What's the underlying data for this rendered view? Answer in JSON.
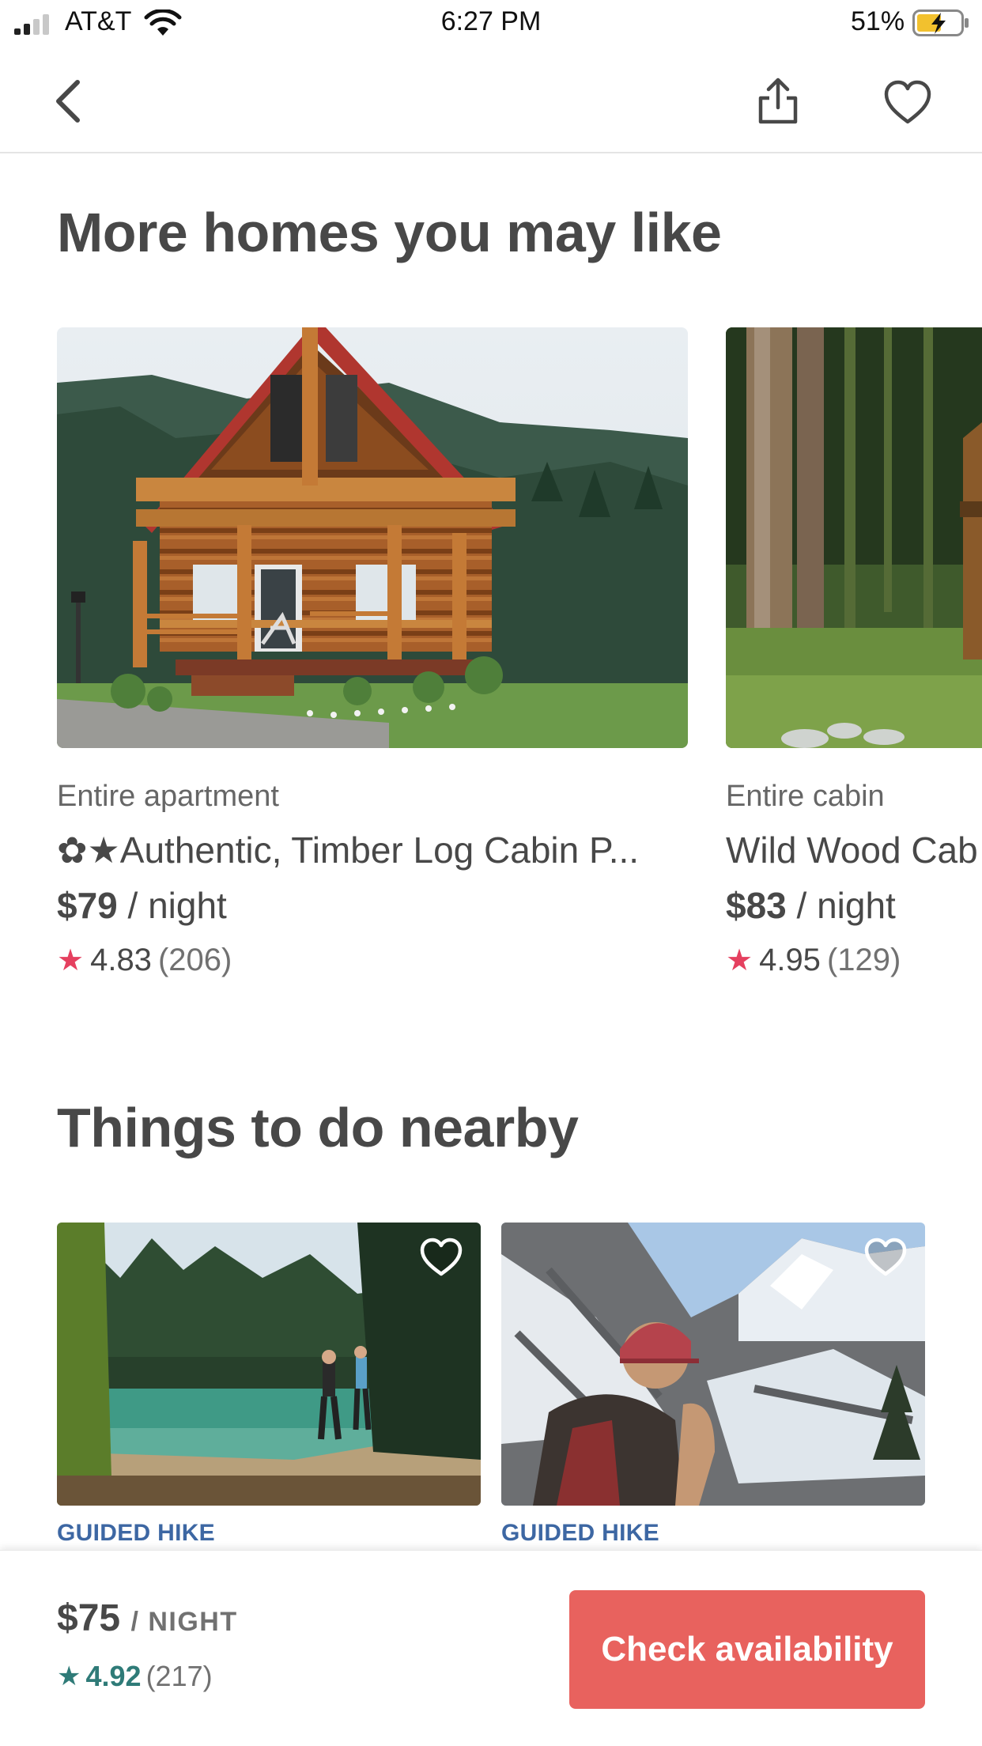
{
  "status_bar": {
    "carrier": "AT&T",
    "time": "6:27 PM",
    "battery_percent": "51%",
    "signal_bars_active": 2,
    "signal_bars_total": 4,
    "icons": [
      "signal-icon",
      "wifi-icon",
      "battery-charging-icon"
    ]
  },
  "nav": {
    "icons": [
      "back-chevron-icon",
      "share-icon",
      "heart-icon"
    ]
  },
  "more_homes": {
    "title": "More homes you may like",
    "listings": [
      {
        "type": "Entire apartment",
        "title": "✿★Authentic, Timber Log Cabin P...",
        "price": "$79",
        "price_unit": " / night",
        "rating": "4.83",
        "reviews": "(206)"
      },
      {
        "type": "Entire cabin",
        "title": "Wild Wood Cab",
        "price": "$83",
        "price_unit": " / night",
        "rating": "4.95",
        "reviews": "(129)"
      }
    ]
  },
  "things_to_do": {
    "title": "Things to do nearby",
    "experiences": [
      {
        "kind": "GUIDED HIKE",
        "icon": "heart-outline-icon"
      },
      {
        "kind": "GUIDED HIKE",
        "icon": "heart-outline-icon"
      }
    ]
  },
  "booking_bar": {
    "price": "$75",
    "price_unit": "/ NIGHT",
    "rating": "4.92",
    "reviews": "(217)",
    "cta_label": "Check availability"
  },
  "colors": {
    "brand_coral": "#e8625e",
    "star_red": "#e5405f",
    "rating_teal": "#2f7b78",
    "experience_blue": "#3d67a3",
    "text_dark": "#484848"
  }
}
